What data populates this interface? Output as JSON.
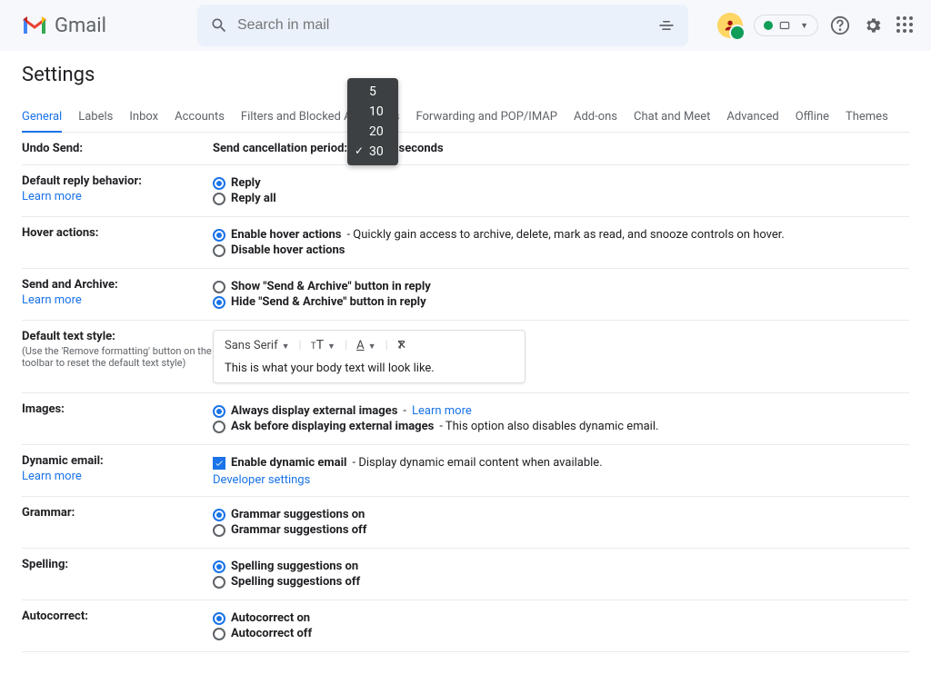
{
  "header": {
    "app_name": "Gmail",
    "search_placeholder": "Search in mail"
  },
  "page_title": "Settings",
  "tabs": [
    "General",
    "Labels",
    "Inbox",
    "Accounts",
    "Filters and Blocked Addresses",
    "Forwarding and POP/IMAP",
    "Add-ons",
    "Chat and Meet",
    "Advanced",
    "Offline",
    "Themes"
  ],
  "dropdown": {
    "options": [
      "5",
      "10",
      "20",
      "30"
    ],
    "selected": "30"
  },
  "sections": {
    "undo": {
      "label": "Undo Send:",
      "text_left": "Send cancellation period:",
      "text_right": "seconds"
    },
    "reply": {
      "label": "Default reply behavior:",
      "learn": "Learn more",
      "opt1": "Reply",
      "opt2": "Reply all"
    },
    "hover": {
      "label": "Hover actions:",
      "opt1": "Enable hover actions",
      "opt1_desc": " - Quickly gain access to archive, delete, mark as read, and snooze controls on hover.",
      "opt2": "Disable hover actions"
    },
    "archive": {
      "label": "Send and Archive:",
      "learn": "Learn more",
      "opt1": "Show \"Send & Archive\" button in reply",
      "opt2": "Hide \"Send & Archive\" button in reply"
    },
    "textstyle": {
      "label": "Default text style:",
      "hint": "(Use the 'Remove formatting' button on the toolbar to reset the default text style)",
      "font": "Sans Serif",
      "preview": "This is what your body text will look like."
    },
    "images": {
      "label": "Images:",
      "opt1": "Always display external images",
      "opt1_link": "Learn more",
      "opt2": "Ask before displaying external images",
      "opt2_desc": " - This option also disables dynamic email."
    },
    "dynamic": {
      "label": "Dynamic email:",
      "learn": "Learn more",
      "opt1": "Enable dynamic email",
      "opt1_desc": " - Display dynamic email content when available.",
      "dev": "Developer settings"
    },
    "grammar": {
      "label": "Grammar:",
      "opt1": "Grammar suggestions on",
      "opt2": "Grammar suggestions off"
    },
    "spelling": {
      "label": "Spelling:",
      "opt1": "Spelling suggestions on",
      "opt2": "Spelling suggestions off"
    },
    "autocorrect": {
      "label": "Autocorrect:",
      "opt1": "Autocorrect on",
      "opt2": "Autocorrect off"
    }
  }
}
